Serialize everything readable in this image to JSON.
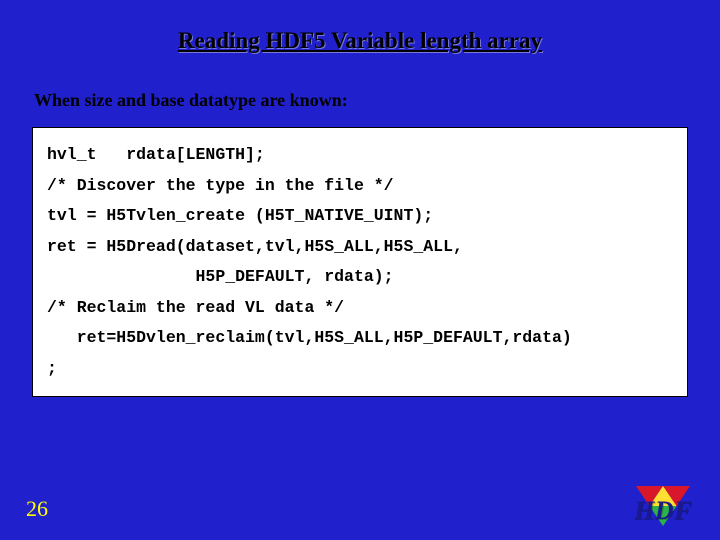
{
  "title": "Reading HDF5 Variable length array",
  "subhead": "When size and base datatype are known:",
  "code": "hvl_t   rdata[LENGTH];\n/* Discover the type in the file */\ntvl = H5Tvlen_create (H5T_NATIVE_UINT);\nret = H5Dread(dataset,tvl,H5S_ALL,H5S_ALL,\n               H5P_DEFAULT, rdata);\n/* Reclaim the read VL data */\n   ret=H5Dvlen_reclaim(tvl,H5S_ALL,H5P_DEFAULT,rdata)\n;",
  "page_number": "26",
  "logo_text": "HDF",
  "colors": {
    "background": "#2020cc",
    "accent": "#ffff00",
    "codebg": "#ffffff"
  }
}
